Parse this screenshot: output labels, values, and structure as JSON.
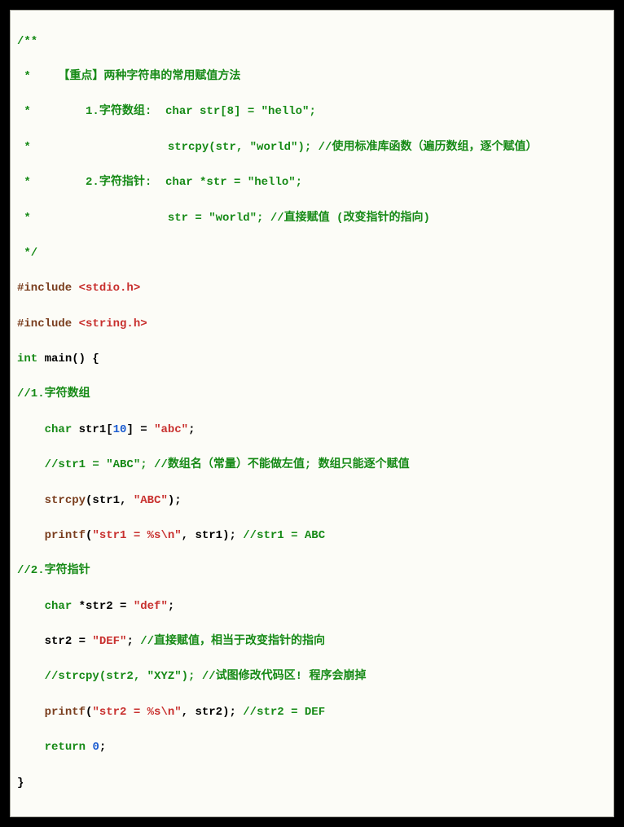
{
  "code": {
    "l1": "/**",
    "l2a": " *    【重点】两种字符串的常用赋值方法",
    "l3a": " *        1.字符数组:  char str[8] = \"hello\";",
    "l4a": " *                    strcpy(str, \"world\"); //使用标准库函数（遍历数组，逐个赋值）",
    "l5a": " *        2.字符指针:  char *str = \"hello\";",
    "l6a": " *                    str = \"world\"; //直接赋值 (改变指针的指向)",
    "l7": " */",
    "inc1_a": "#include ",
    "inc1_b": "<stdio.h>",
    "inc2_a": "#include ",
    "inc2_b": "<string.h>",
    "main_kw": "int",
    "main_rest": " main() {",
    "cm1": "//1.字符数组",
    "d1_kw": "char",
    "d1_mid": " str1[",
    "d1_num": "10",
    "d1_end": "] = ",
    "d1_str": "\"abc\"",
    "d1_semi": ";",
    "cm2": "//str1 = \"ABC\"; //数组名（常量）不能做左值; 数组只能逐个赋值",
    "sc_fn": "strcpy",
    "sc_mid": "(str1, ",
    "sc_str": "\"ABC\"",
    "sc_end": ");",
    "pf1_fn": "printf",
    "pf1_open": "(",
    "pf1_str": "\"str1 = %s\\n\"",
    "pf1_rest": ", str1); ",
    "pf1_cm": "//str1 = ABC",
    "cm3": "//2.字符指针",
    "d2_kw": "char",
    "d2_mid": " *str2 = ",
    "d2_str": "\"def\"",
    "d2_semi": ";",
    "as_lhs": "str2 = ",
    "as_str": "\"DEF\"",
    "as_semi": "; ",
    "as_cm": "//直接赋值，相当于改变指针的指向",
    "cm4": "//strcpy(str2, \"XYZ\"); //试图修改代码区! 程序会崩掉",
    "pf2_fn": "printf",
    "pf2_open": "(",
    "pf2_str": "\"str2 = %s\\n\"",
    "pf2_rest": ", str2); ",
    "pf2_cm": "//str2 = DEF",
    "ret_kw": "return",
    "ret_sp": " ",
    "ret_num": "0",
    "ret_semi": ";",
    "close": "}"
  }
}
